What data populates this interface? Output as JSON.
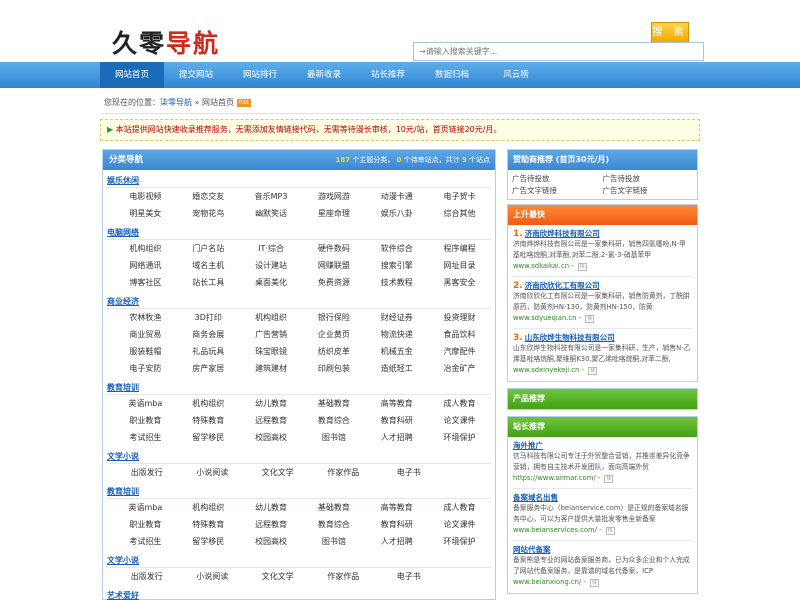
{
  "header": {
    "logo_part1": "久零",
    "logo_part2": "导航",
    "search_button": "搜 索",
    "search_placeholder": "→请输入搜索关键字..."
  },
  "nav": [
    "网站首页",
    "提交网站",
    "网站排行",
    "最新收录",
    "站长推荐",
    "数据归档",
    "风云榜"
  ],
  "breadcrumb": {
    "prefix": "您现在的位置：",
    "site": "柒零导航",
    "separator": " » ",
    "current": "网站首页",
    "badge": "RSS"
  },
  "notice": {
    "arrow": "▶",
    "text": "本站提供网站快速收录推荐服务，无需添加友情链接代码，无需等待漫长审核，10元/站，首页链接20元/月。"
  },
  "main": {
    "title": "分类导航",
    "stats_count_topics": "187",
    "stats_topics_label": "个主题分类，",
    "stats_count_pending": "0",
    "stats_pending_label": "个待审站点，共计",
    "stats_count_total": "9",
    "stats_total_label": "个站点",
    "categories": [
      {
        "title": "娱乐休闲",
        "rows": [
          [
            "电影视频",
            "婚恋交友",
            "音乐MP3",
            "游戏网游",
            "动漫卡通",
            "电子贺卡"
          ],
          [
            "明星美女",
            "宠物花鸟",
            "幽默笑话",
            "星座命理",
            "娱乐八卦",
            "综合其他"
          ]
        ]
      },
      {
        "title": "电脑网络",
        "rows": [
          [
            "机构组织",
            "门户名站",
            "IT·综合",
            "硬件数码",
            "软件综合",
            "程序编程"
          ],
          [
            "网络通讯",
            "域名主机",
            "设计建站",
            "网赚联盟",
            "搜索引擎",
            "网址目录"
          ],
          [
            "博客社区",
            "站长工具",
            "桌面美化",
            "免费资源",
            "技术教程",
            "黑客安全"
          ]
        ]
      },
      {
        "title": "商业经济",
        "rows": [
          [
            "农林牧渔",
            "3D打印",
            "机构组织",
            "银行保险",
            "财经证券",
            "投资理财"
          ],
          [
            "商业贸易",
            "商务会展",
            "广告营销",
            "企业黄页",
            "物流快递",
            "食品饮料"
          ],
          [
            "服装鞋帽",
            "礼品玩具",
            "珠宝眼镜",
            "纺织皮革",
            "机械五金",
            "汽摩配件"
          ],
          [
            "电子安防",
            "房产家居",
            "建筑建材",
            "印刷包装",
            "造纸轻工",
            "冶金矿产"
          ]
        ]
      },
      {
        "title": "教育培训",
        "rows": [
          [
            "英语mba",
            "机构组织",
            "幼儿教育",
            "基础教育",
            "高等教育",
            "成人教育"
          ],
          [
            "职业教育",
            "特殊教育",
            "远程教育",
            "教育综合",
            "教育科研",
            "论文课件"
          ],
          [
            "考试招生",
            "留学移民",
            "校园高校",
            "图书馆",
            "人才招聘",
            "环境保护"
          ]
        ]
      },
      {
        "title": "文学小说",
        "rows": [
          [
            "出版发行",
            "小说阅读",
            "文化文学",
            "作家作品",
            "电子书"
          ]
        ]
      },
      {
        "title": "教育培训",
        "rows": [
          [
            "英语mba",
            "机构组织",
            "幼儿教育",
            "基础教育",
            "高等教育",
            "成人教育"
          ],
          [
            "职业教育",
            "特殊教育",
            "远程教育",
            "教育综合",
            "教育科研",
            "论文课件"
          ],
          [
            "考试招生",
            "留学移民",
            "校园高校",
            "图书馆",
            "人才招聘",
            "环境保护"
          ]
        ]
      },
      {
        "title": "文学小说",
        "rows": [
          [
            "出版发行",
            "小说阅读",
            "文化文学",
            "作家作品",
            "电子书"
          ]
        ]
      },
      {
        "title": "艺术爱好",
        "rows": []
      }
    ]
  },
  "side": {
    "sponsor_title": "赞助商推荐 (首页30元/月)",
    "ads": [
      "广告待投放",
      "广告待投放",
      "广告文字链接",
      "广告文字链接"
    ],
    "rising_title": "上升最快",
    "rising": [
      {
        "num": "1.",
        "name": "济南欣烨科技有限公司",
        "desc": "济南烨烨科技有限公司是一家集科研，销售四氢噻吩,N-甲基吡咯烷酮,对苯酚,对苯二酚,2-氯-3-硝基苯甲",
        "url": "www.sdkaikai.cn",
        "sep": " - ",
        "snap": "快"
      },
      {
        "num": "2.",
        "name": "济南欣欣化工有限公司",
        "desc": "济南欣欣化工有限公司是一家集科研，销售防黄剂，丁酰肼原药，防黄剂HN-130，防黄剂HN-150，防黄",
        "url": "www.sdyueqian.cn",
        "sep": " - ",
        "snap": "快"
      },
      {
        "num": "3.",
        "name": "山东欣烨生物科技有限公司",
        "desc": "山东欣烨生物科技有限公司是一家集科研，生产，销售N-乙烯基吡咯烷酮,聚维酮K30,聚乙烯吡咯烷酮,对苯二酚,",
        "url": "www.sdxinyekeji.cn",
        "sep": " - ",
        "snap": "快"
      }
    ],
    "product_title": "产品推荐",
    "recommend_title": "站长推荐",
    "recommend": [
      {
        "name": "海外推广",
        "desc": "信马科技有限公司专注于外贸整合营销，并推崇差异化竞争营销，拥有自主技术开发团队，面向高端外贸",
        "url": "https://www.sirmar.com/",
        "sep": " - ",
        "snap": "快"
      },
      {
        "name": "备案域名出售",
        "desc": "备案服务中心（beianservice.com）是正规的备案域名服务中心，可以为客户提供大量批发零售全新备案",
        "url": "www.beianservices.com/",
        "sep": " - ",
        "snap": "快"
      },
      {
        "name": "网站代备案",
        "desc": "备案熊是专业的网站备案服务商，已为众多企业和个人完成了网站代备案服务，是靠谱的域名代备案，ICP",
        "url": "www.beianxiong.cn/",
        "sep": " - ",
        "snap": "快"
      }
    ]
  }
}
